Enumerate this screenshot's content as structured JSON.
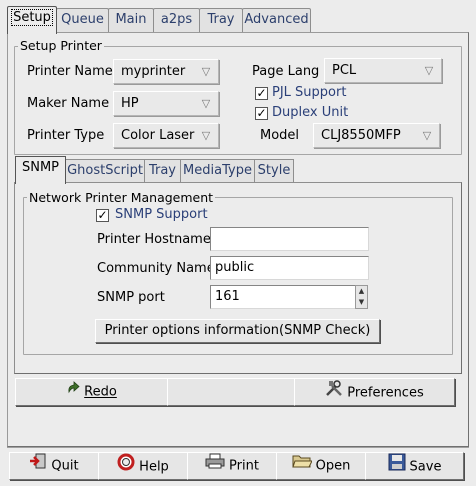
{
  "top_tabs": [
    "Setup",
    "Queue",
    "Main",
    "a2ps",
    "Tray",
    "Advanced"
  ],
  "setup_printer": {
    "title": "Setup Printer",
    "printer_name_label": "Printer Name",
    "printer_name_value": "myprinter",
    "maker_name_label": "Maker Name",
    "maker_name_value": "HP",
    "printer_type_label": "Printer Type",
    "printer_type_value": "Color Laser",
    "page_lang_label": "Page Lang",
    "page_lang_value": "PCL",
    "pjl_support_label": "PJL Support",
    "pjl_support_checked": true,
    "duplex_unit_label": "Duplex Unit",
    "duplex_unit_checked": true,
    "model_label": "Model",
    "model_value": "CLJ8550MFP"
  },
  "inner_tabs": [
    "SNMP",
    "GhostScript",
    "Tray",
    "MediaType",
    "Style"
  ],
  "snmp": {
    "group_title": "Network Printer Management",
    "snmp_support_label": "SNMP Support",
    "snmp_support_checked": true,
    "hostname_label": "Printer Hostname",
    "hostname_value": "",
    "community_label": "Community Name",
    "community_value": "public",
    "port_label": "SNMP port",
    "port_value": "161",
    "check_button": "Printer options information(SNMP Check)"
  },
  "action_bar": {
    "redo": "Redo",
    "preferences": "Preferences"
  },
  "bottom_bar": {
    "quit": "Quit",
    "help": "Help",
    "print": "Print",
    "open": "Open",
    "save": "Save"
  }
}
